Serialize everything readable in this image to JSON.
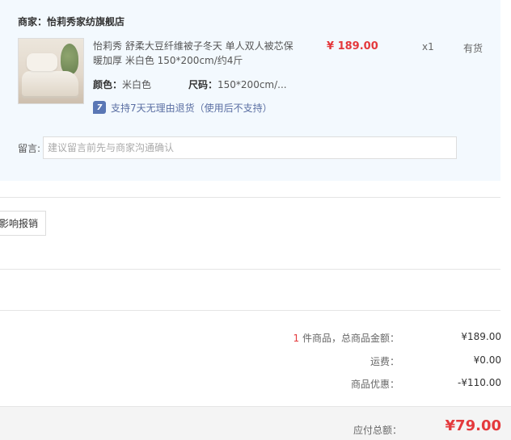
{
  "shop": {
    "label": "商家：",
    "name": "怡莉秀家纺旗舰店"
  },
  "item": {
    "title": "怡莉秀 舒柔大豆纤维被子冬天 单人双人被芯保暖加厚 米白色 150*200cm/约4斤",
    "price": "¥ 189.00",
    "qty": "x1",
    "stock": "有货",
    "color_label": "颜色：",
    "color_value": "米白色",
    "size_label": "尺码：",
    "size_value": "150*200cm/...",
    "return_icon": "7",
    "return_text": "支持7天无理由退货（使用后不支持）"
  },
  "message": {
    "label": "留言:",
    "placeholder": "建议留言前先与商家沟通确认"
  },
  "invoice": {
    "button_label": "影响报销"
  },
  "summary": {
    "count": "1",
    "count_suffix": " 件商品，总商品金额：",
    "goods_total": "¥189.00",
    "shipping_label": "运费：",
    "shipping_value": "¥0.00",
    "discount_label": "商品优惠：",
    "discount_value": "-¥110.00"
  },
  "total": {
    "label": "应付总额：",
    "value": "¥79.00"
  },
  "colors": {
    "accent_red": "#e4393c",
    "shop_bg": "#f3f9fe",
    "return_icon_bg": "#5a77b5"
  },
  "icons": {
    "return_policy": "seven-day-return-icon"
  }
}
